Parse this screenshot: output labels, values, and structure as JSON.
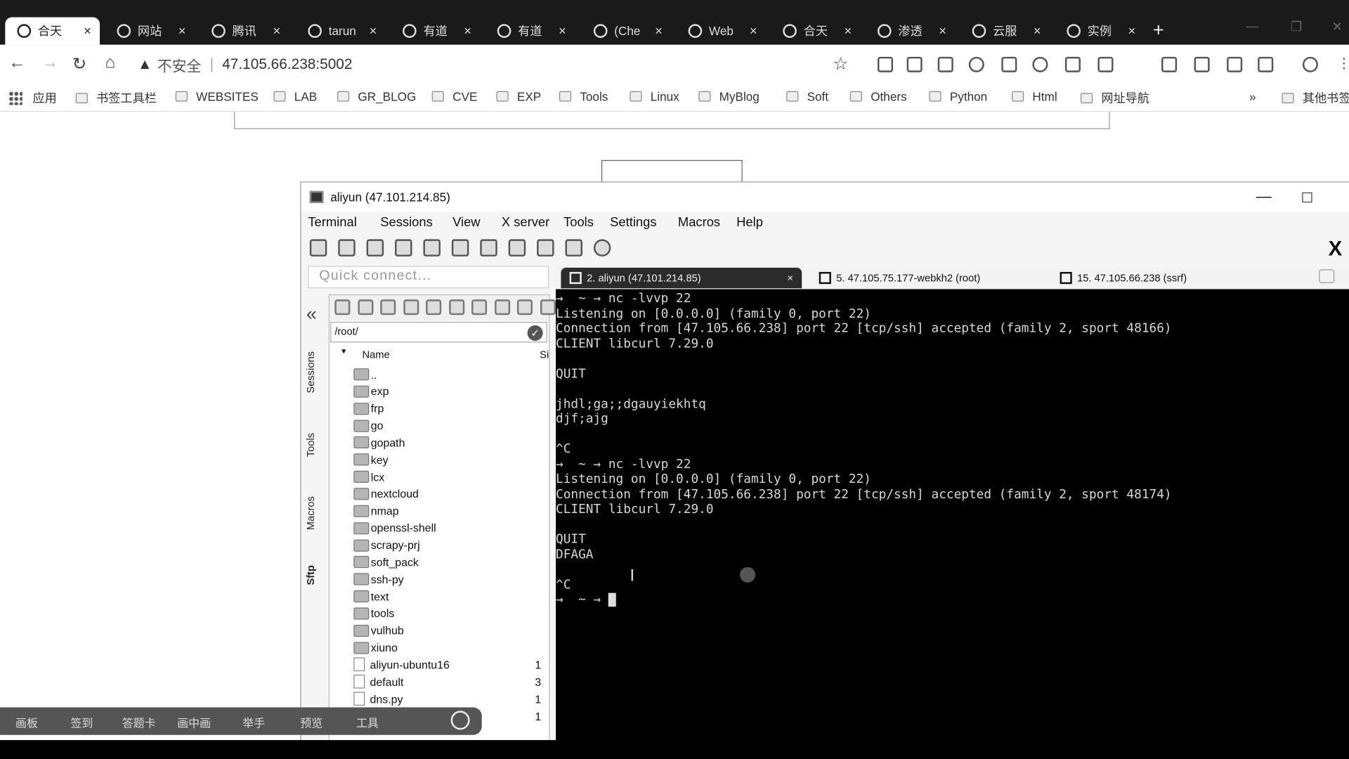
{
  "browser": {
    "tabs": [
      {
        "label": "合天",
        "active": true
      },
      {
        "label": "网站"
      },
      {
        "label": "腾讯"
      },
      {
        "label": "tarun"
      },
      {
        "label": "有道"
      },
      {
        "label": "有道"
      },
      {
        "label": "(Che"
      },
      {
        "label": "Web"
      },
      {
        "label": "合天"
      },
      {
        "label": "渗透"
      },
      {
        "label": "云服"
      },
      {
        "label": "实例"
      }
    ],
    "new_tab": "+",
    "security_label": "不安全",
    "url": "47.105.66.238:5002",
    "bookmarks": [
      "应用",
      "书签工具栏",
      "WEBSITES",
      "LAB",
      "GR_BLOG",
      "CVE",
      "EXP",
      "Tools",
      "Linux",
      "MyBlog",
      "Soft",
      "Others",
      "Python",
      "Html",
      "网址导航"
    ],
    "bookmarks_more": "»",
    "other_bookmarks": "其他书签"
  },
  "moba": {
    "title": "aliyun (47.101.214.85)",
    "menu": [
      "Terminal",
      "Sessions",
      "View",
      "X server",
      "Tools",
      "Settings",
      "Macros",
      "Help"
    ],
    "quick_connect_placeholder": "Quick connect...",
    "side_tabs": [
      "Sessions",
      "Tools",
      "Macros",
      "Sftp"
    ],
    "path": "/root/",
    "columns": {
      "name": "Name",
      "size": "Si"
    },
    "files": [
      {
        "name": "..",
        "type": "up",
        "size": ""
      },
      {
        "name": "exp",
        "type": "folder",
        "size": ""
      },
      {
        "name": "frp",
        "type": "folder",
        "size": ""
      },
      {
        "name": "go",
        "type": "folder",
        "size": ""
      },
      {
        "name": "gopath",
        "type": "folder",
        "size": ""
      },
      {
        "name": "key",
        "type": "folder",
        "size": ""
      },
      {
        "name": "lcx",
        "type": "folder",
        "size": ""
      },
      {
        "name": "nextcloud",
        "type": "folder",
        "size": ""
      },
      {
        "name": "nmap",
        "type": "folder",
        "size": ""
      },
      {
        "name": "openssl-shell",
        "type": "folder",
        "size": ""
      },
      {
        "name": "scrapy-prj",
        "type": "folder",
        "size": ""
      },
      {
        "name": "soft_pack",
        "type": "folder",
        "size": ""
      },
      {
        "name": "ssh-py",
        "type": "folder",
        "size": ""
      },
      {
        "name": "text",
        "type": "folder",
        "size": ""
      },
      {
        "name": "tools",
        "type": "folder",
        "size": ""
      },
      {
        "name": "vulhub",
        "type": "folder",
        "size": ""
      },
      {
        "name": "xiuno",
        "type": "folder",
        "size": ""
      },
      {
        "name": "aliyun-ubuntu16",
        "type": "file",
        "size": "1"
      },
      {
        "name": "default",
        "type": "file",
        "size": "3"
      },
      {
        "name": "dns.py",
        "type": "file",
        "size": "1"
      },
      {
        "name": "",
        "type": "file",
        "size": "1"
      }
    ],
    "terminal_tabs": [
      {
        "label": "2. aliyun (47.101.214.85)",
        "active": true
      },
      {
        "label": "5. 47.105.75.177-webkh2 (root)"
      },
      {
        "label": "15. 47.105.66.238 (ssrf)"
      }
    ],
    "terminal_lines": [
      "→  ~ → nc -lvvp 22",
      "Listening on [0.0.0.0] (family 0, port 22)",
      "Connection from [47.105.66.238] port 22 [tcp/ssh] accepted (family 2, sport 48166)",
      "CLIENT libcurl 7.29.0",
      "",
      "QUIT",
      "",
      "jhdl;ga;;dgauyiekhtq",
      "djf;ajg",
      "",
      "^C",
      "→  ~ → nc -lvvp 22",
      "Listening on [0.0.0.0] (family 0, port 22)",
      "Connection from [47.105.66.238] port 22 [tcp/ssh] accepted (family 2, sport 48174)",
      "CLIENT libcurl 7.29.0",
      "",
      "QUIT",
      "DFAGA",
      "",
      "^C"
    ],
    "prompt": "→  ~ → "
  },
  "overlay": {
    "items": [
      "画板",
      "签到",
      "答题卡",
      "画中画",
      "举手",
      "预览",
      "工具"
    ]
  }
}
